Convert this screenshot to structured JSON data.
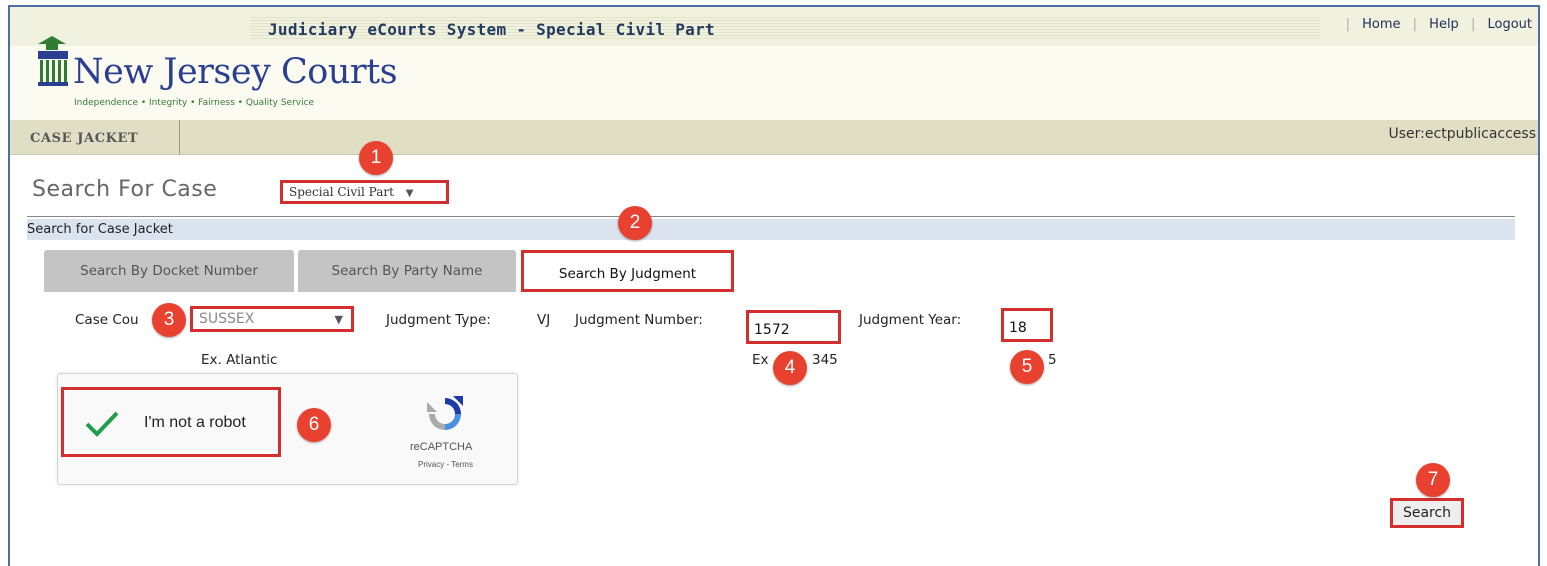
{
  "header": {
    "system_title": "Judiciary eCourts System - Special Civil Part",
    "links": [
      "Home",
      "Help",
      "Logout"
    ],
    "logo_title": "New Jersey Courts",
    "logo_tagline": "Independence • Integrity • Fairness • Quality Service"
  },
  "nav": {
    "tab_label": "CASE JACKET",
    "user_label": "User:ectpublicaccess"
  },
  "page": {
    "title": "Search For Case",
    "court_select_value": "Special Civil Part",
    "section_title": "Search for Case Jacket"
  },
  "tabs": [
    {
      "label": "Search By Docket Number",
      "active": false
    },
    {
      "label": "Search By Party Name",
      "active": false
    },
    {
      "label": "Search By Judgment",
      "active": true
    }
  ],
  "form": {
    "county_label": "Case Cou",
    "county_value": "SUSSEX",
    "county_example": "Ex. Atlantic",
    "judgment_type_label": "Judgment Type:",
    "judgment_type_value": "VJ",
    "judgment_number_label": "Judgment Number:",
    "judgment_number_value": "1572",
    "judgment_number_example_left": "Ex",
    "judgment_number_example_right": "345",
    "judgment_year_label": "Judgment Year:",
    "judgment_year_value": "18",
    "judgment_year_example": "5"
  },
  "captcha": {
    "label": "I'm not a robot",
    "brand": "reCAPTCHA",
    "links": "Privacy - Terms"
  },
  "actions": {
    "search_label": "Search"
  },
  "annotations": [
    "1",
    "2",
    "3",
    "4",
    "5",
    "6",
    "7"
  ],
  "colors": {
    "highlight_border": "#d32f2f",
    "badge": "#e8412f",
    "logo_blue": "#2a3f8f",
    "section_bar": "#dbe3ef"
  }
}
